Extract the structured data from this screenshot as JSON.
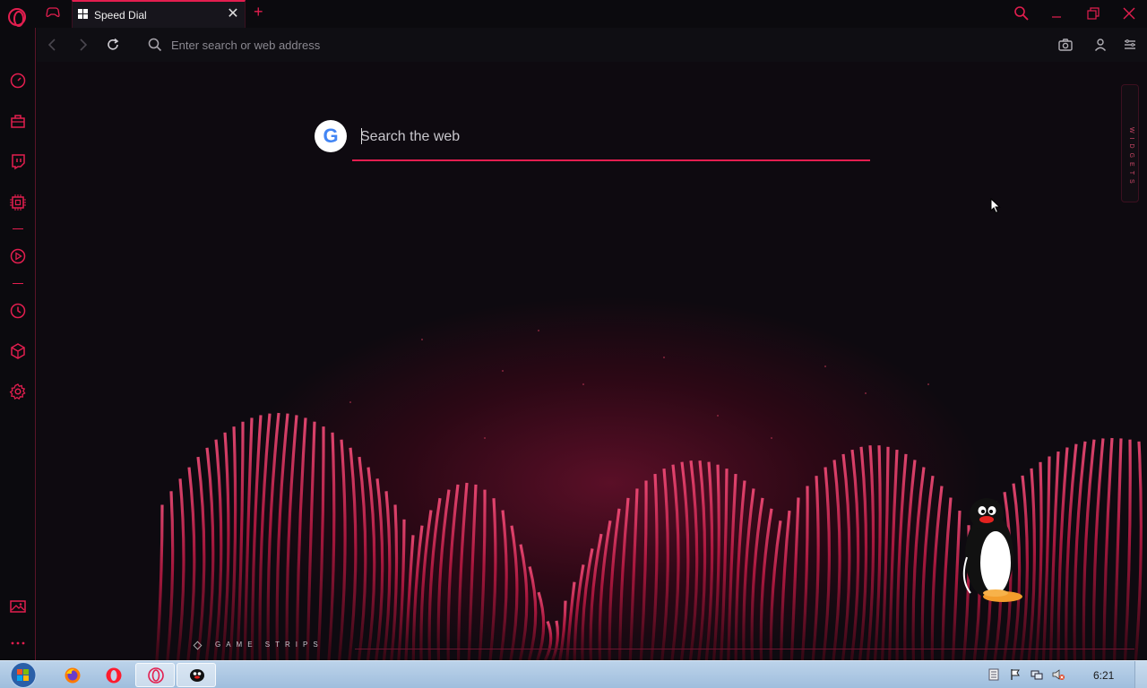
{
  "browser": {
    "tab_title": "Speed Dial",
    "address_placeholder": "Enter search or web address"
  },
  "speed_dial": {
    "search_placeholder": "Search the web",
    "search_engine_letter": "G",
    "widgets_label": "WIDGETS",
    "game_strips_label": "GAME STRIPS"
  },
  "sidebar": {
    "items": [
      "speedometer-icon",
      "bag-icon",
      "twitch-icon",
      "cpu-icon",
      "player-icon",
      "history-icon",
      "cube-icon",
      "settings-icon",
      "wallpaper-icon",
      "more-icon"
    ]
  },
  "taskbar": {
    "clock": "6:21",
    "apps": [
      "firefox",
      "opera",
      "opera-gx",
      "pingu"
    ]
  },
  "colors": {
    "accent": "#e31e4f",
    "background": "#0b0a0e",
    "taskbar": "#b3cce6"
  }
}
